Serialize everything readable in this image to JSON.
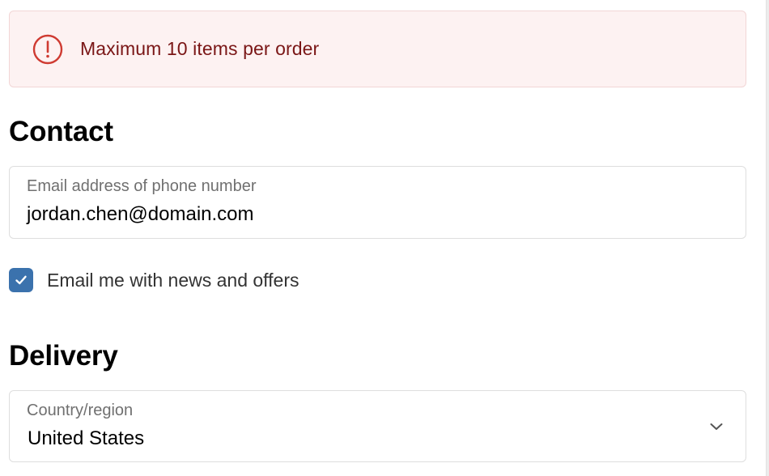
{
  "banner": {
    "icon": "alert-circle-icon",
    "message": "Maximum 10 items per order",
    "color": "#c0392b"
  },
  "contact": {
    "heading": "Contact",
    "email_field": {
      "label": "Email address of phone number",
      "value": "jordan.chen@domain.com"
    },
    "newsletter": {
      "label": "Email me with news and offers",
      "checked": true
    }
  },
  "delivery": {
    "heading": "Delivery",
    "country_field": {
      "label": "Country/region",
      "value": "United States",
      "icon": "chevron-down-icon"
    }
  },
  "colors": {
    "accent": "#3b72ad",
    "error_text": "#7a1616",
    "error_bg": "#fdf2f2"
  }
}
